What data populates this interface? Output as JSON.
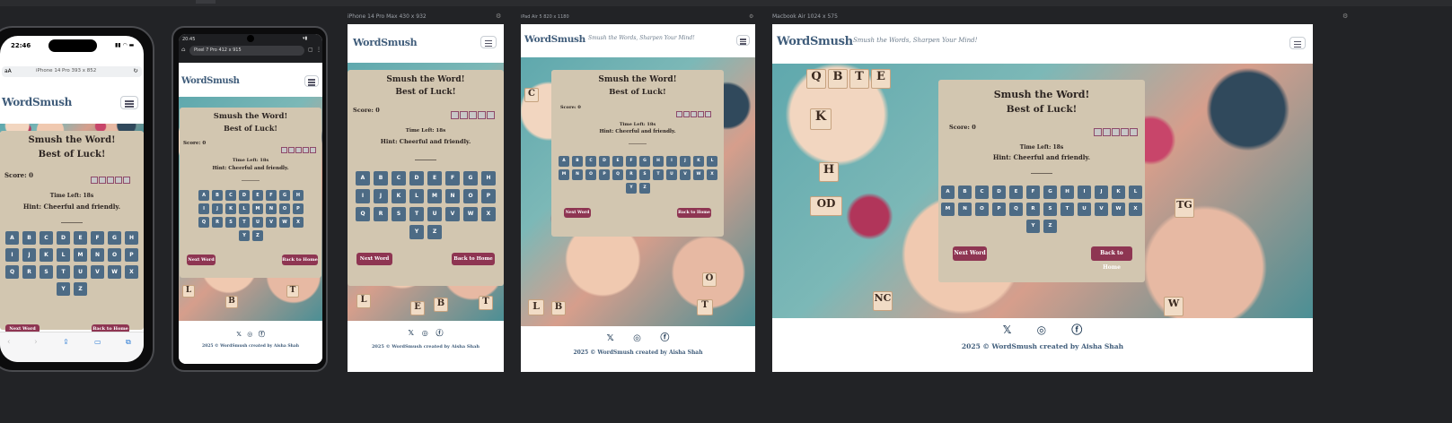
{
  "brand": "WordSmush",
  "tagline": "Smush the Words, Sharpen Your Mind!",
  "game": {
    "title": "Smush the Word!",
    "subtitle": "Best of Luck!",
    "score": "Score: 0",
    "time_left": "Time Left: 18s",
    "hint": "Hint: Cheerful and friendly.",
    "blank": "________",
    "next_word": "Next Word",
    "back_home": "Back to Home",
    "keys": [
      "A",
      "B",
      "C",
      "D",
      "E",
      "F",
      "G",
      "H",
      "I",
      "J",
      "K",
      "L",
      "M",
      "N",
      "O",
      "P",
      "Q",
      "R",
      "S",
      "T",
      "U",
      "V",
      "W",
      "X",
      "Y",
      "Z"
    ]
  },
  "footer": {
    "text": "2025 © WordSmush created by Aisha Shah"
  },
  "devices": {
    "iphone_pro": {
      "time": "22:46",
      "aa": "aA",
      "url": "iPhone 14 Pro   393 x 852"
    },
    "pixel": {
      "time": "20:45",
      "url": "Pixel 7 Pro  412 x 915"
    },
    "iphone_max": {
      "label": "iPhone 14 Pro Max  430 x 932"
    },
    "ipad": {
      "label": "iPad Air 5  820 x 1180"
    },
    "macbook": {
      "label": "Macbook Air  1024 x 575"
    }
  },
  "icons": {
    "x": "x-icon",
    "instagram": "instagram-icon",
    "facebook": "facebook-icon",
    "hamburger": "hamburger-icon",
    "gear": "gear-icon"
  }
}
